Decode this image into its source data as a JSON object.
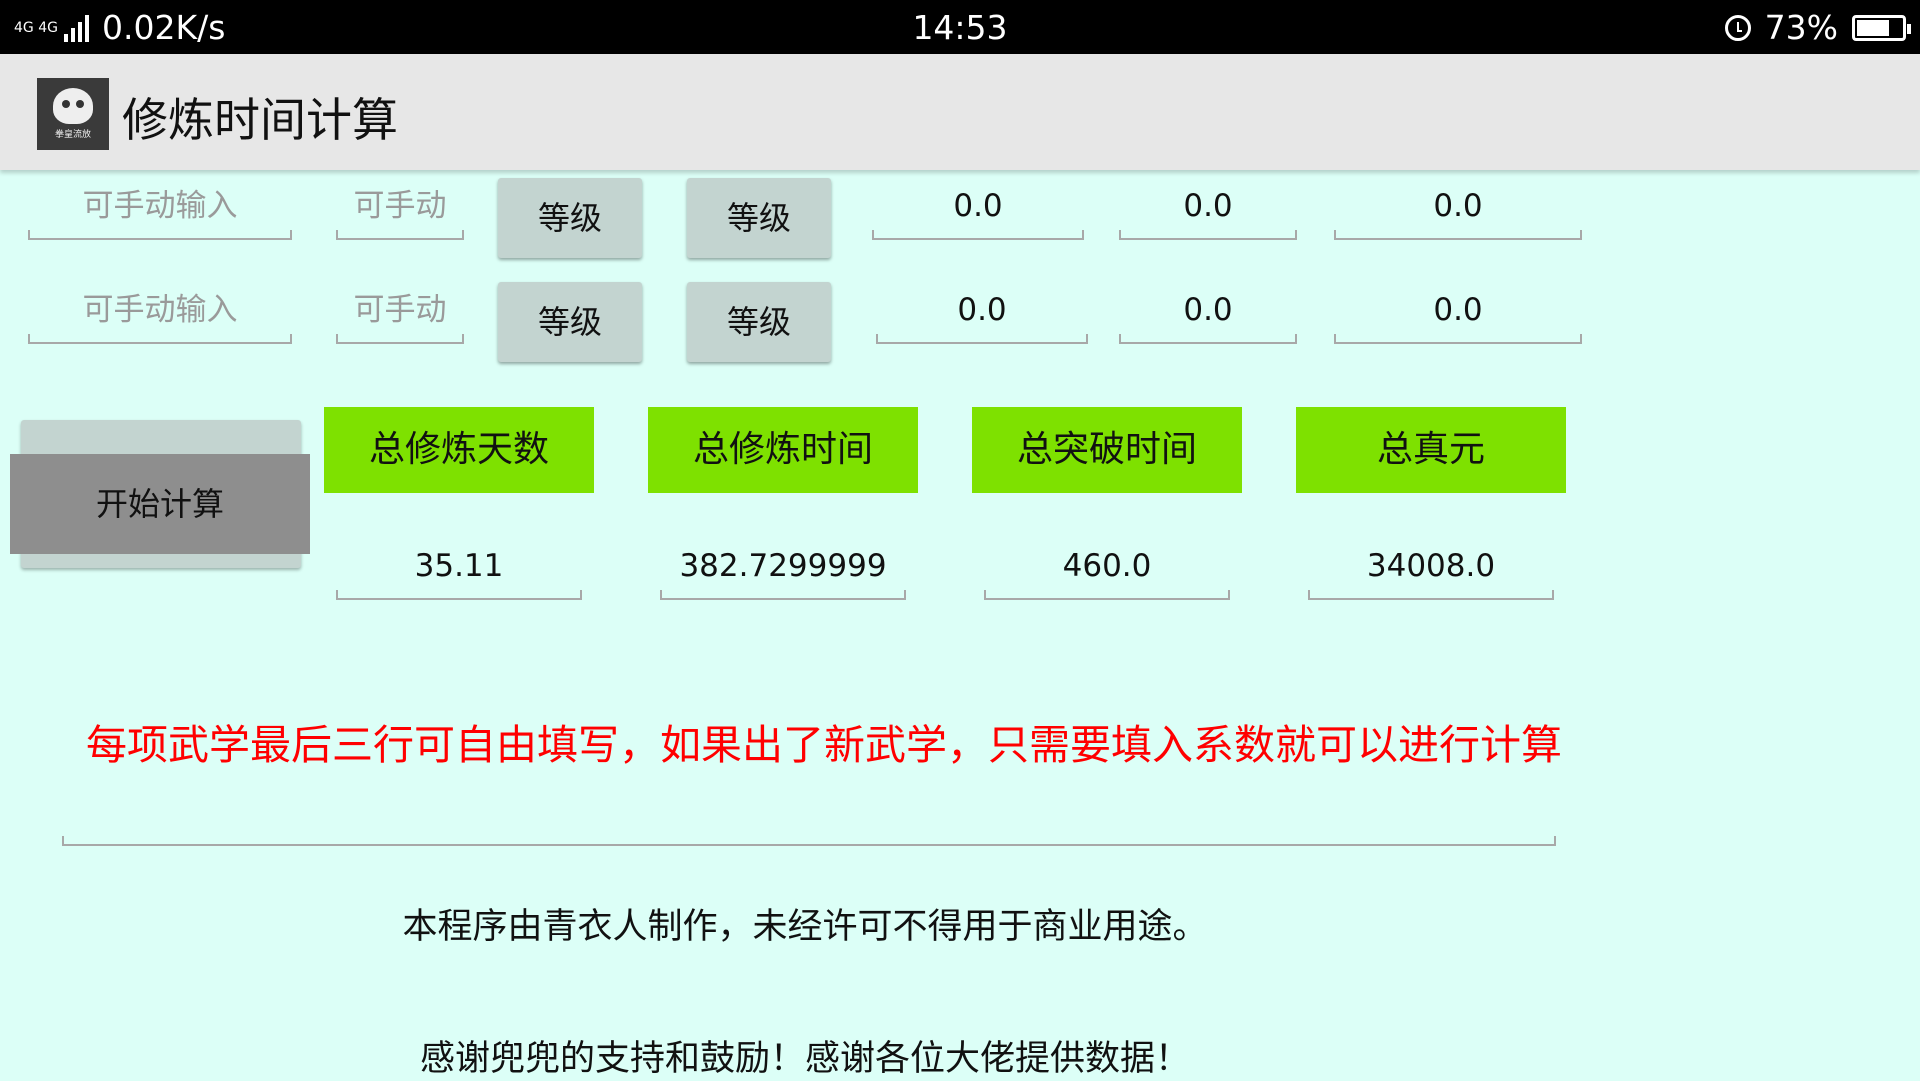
{
  "status_bar": {
    "network": "4G 4G",
    "speed": "0.02K/s",
    "time": "14:53",
    "battery": "73%",
    "battery_level": 0.73
  },
  "app": {
    "title": "修炼时间计算",
    "icon_caption": "拳皇流放"
  },
  "rows": [
    {
      "name_placeholder": "可手动输入",
      "coef_placeholder": "可手动",
      "level1_label": "等级",
      "level2_label": "等级",
      "values": [
        "0.0",
        "0.0",
        "0.0"
      ]
    },
    {
      "name_placeholder": "可手动输入",
      "coef_placeholder": "可手动",
      "level1_label": "等级",
      "level2_label": "等级",
      "values": [
        "0.0",
        "0.0",
        "0.0"
      ]
    }
  ],
  "calc_button": "开始计算",
  "totals": [
    {
      "label": "总修炼天数",
      "value": "35.11"
    },
    {
      "label": "总修炼时间",
      "value": "382.7299999"
    },
    {
      "label": "总突破时间",
      "value": "460.0"
    },
    {
      "label": "总真元",
      "value": "34008.0"
    }
  ],
  "colors": {
    "background": "#dcfff7",
    "accent_green": "#7ee100",
    "note_red": "#ff0000"
  },
  "notes": {
    "instruction": "每项武学最后三行可自由填写，如果出了新武学，只需要填入系数就可以进行计算",
    "copyright": "本程序由青衣人制作，未经许可不得用于商业用途。",
    "thanks": "感谢兜兜的支持和鼓励！感谢各位大佬提供数据！"
  }
}
